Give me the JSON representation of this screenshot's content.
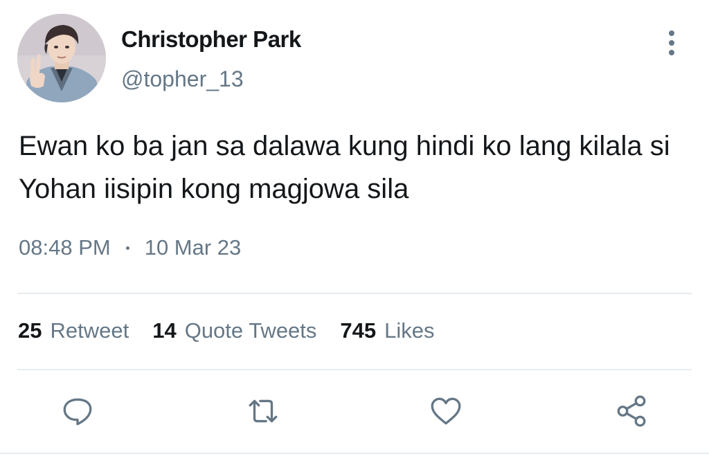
{
  "user": {
    "display_name": "Christopher Park",
    "handle": "@topher_13",
    "avatar_icon": "profile-photo"
  },
  "menu": {
    "more_icon": "more-vertical-icon"
  },
  "tweet": {
    "text": "Ewan ko ba jan sa dalawa kung hindi ko lang kilala si Yohan iisipin kong magjowa sila",
    "time": "08:48 PM",
    "date": "10 Mar 23"
  },
  "stats": {
    "retweets": {
      "count": "25",
      "label": "Retweet"
    },
    "quotes": {
      "count": "14",
      "label": "Quote Tweets"
    },
    "likes": {
      "count": "745",
      "label": "Likes"
    }
  },
  "actions": [
    "reply-icon",
    "retweet-icon",
    "like-icon",
    "share-icon"
  ],
  "colors": {
    "text": "#14171a",
    "secondary": "#657786",
    "divider": "#e6ecf0",
    "background": "#ffffff"
  }
}
